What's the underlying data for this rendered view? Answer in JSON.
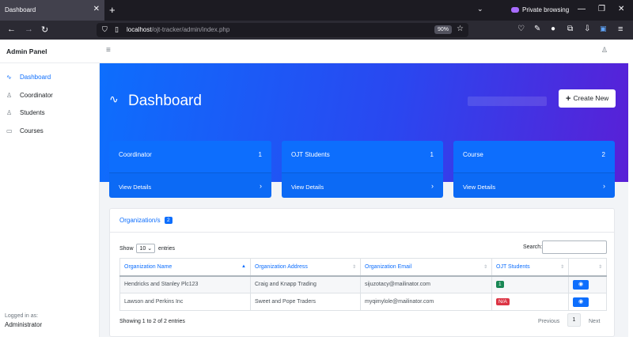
{
  "browser": {
    "tab_title": "Dashboard",
    "url_host": "localhost",
    "url_path": "/ojt-tracker/admin/index.php",
    "zoom": "90%",
    "private_label": "Private browsing"
  },
  "sidebar": {
    "brand": "Admin Panel",
    "items": [
      {
        "label": "Dashboard",
        "icon": "activity-icon",
        "active": true
      },
      {
        "label": "Coordinator",
        "icon": "user-icon",
        "active": false
      },
      {
        "label": "Students",
        "icon": "users-icon",
        "active": false
      },
      {
        "label": "Courses",
        "icon": "book-icon",
        "active": false
      }
    ],
    "logged_in_label": "Logged in as:",
    "logged_in_user": "Administrator"
  },
  "hero": {
    "title": "Dashboard",
    "create_label": "Create New"
  },
  "cards": [
    {
      "label": "Coordinator",
      "count": "1",
      "link": "View Details"
    },
    {
      "label": "OJT Students",
      "count": "1",
      "link": "View Details"
    },
    {
      "label": "Course",
      "count": "2",
      "link": "View Details"
    }
  ],
  "panel": {
    "title": "Organization/s",
    "badge": "2",
    "show_label": "Show",
    "entries_value": "10",
    "entries_label": "entries",
    "search_label": "Search:",
    "columns": [
      "Organization Name",
      "Organization Address",
      "Organization Email",
      "OJT Students",
      ""
    ],
    "rows": [
      {
        "name": "Hendricks and Stanley Plc123",
        "address": "Craig and Knapp Trading",
        "email": "sijuzotacy@mailinator.com",
        "students": "1",
        "students_color": "#198754"
      },
      {
        "name": "Lawson and Perkins Inc",
        "address": "Sweet and Pope Traders",
        "email": "myqimylole@mailinator.com",
        "students": "N/A",
        "students_color": "#dc3545"
      }
    ],
    "info": "Showing 1 to 2 of 2 entries",
    "prev_label": "Previous",
    "page": "1",
    "next_label": "Next"
  }
}
